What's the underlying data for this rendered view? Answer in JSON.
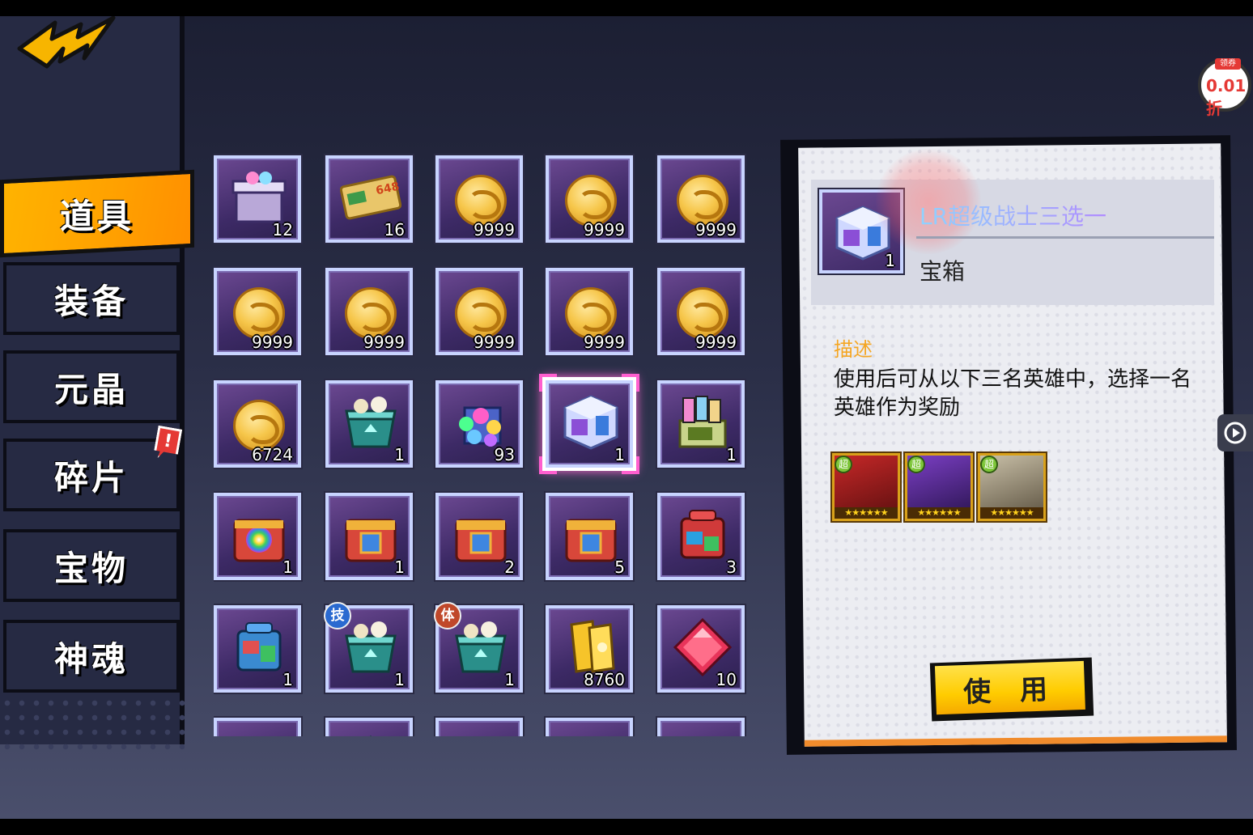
{
  "sidebar": {
    "tabs": [
      {
        "label": "道具",
        "active": true
      },
      {
        "label": "装备",
        "active": false
      },
      {
        "label": "元晶",
        "active": false
      },
      {
        "label": "碎片",
        "active": false,
        "alert": "!"
      },
      {
        "label": "宝物",
        "active": false
      },
      {
        "label": "神魂",
        "active": false
      }
    ]
  },
  "promo": {
    "top": "领券",
    "main": "0.01折"
  },
  "inventory": {
    "items": [
      {
        "icon": "gift-box-icon",
        "count": "12"
      },
      {
        "icon": "ticket-card-icon",
        "count": "16",
        "card_text": "648"
      },
      {
        "icon": "gold-coin-icon",
        "count": "9999"
      },
      {
        "icon": "gold-coin-icon",
        "count": "9999"
      },
      {
        "icon": "gold-coin-icon",
        "count": "9999"
      },
      {
        "icon": "gold-coin-icon",
        "count": "9999"
      },
      {
        "icon": "gold-coin-icon",
        "count": "9999"
      },
      {
        "icon": "gold-coin-icon",
        "count": "9999"
      },
      {
        "icon": "gold-coin-icon",
        "count": "9999"
      },
      {
        "icon": "gold-coin-icon",
        "count": "9999"
      },
      {
        "icon": "gold-coin-icon",
        "count": "6724"
      },
      {
        "icon": "crystal-chest-icon",
        "count": "1"
      },
      {
        "icon": "gem-pile-icon",
        "count": "93"
      },
      {
        "icon": "hero-cube-icon",
        "count": "1",
        "selected": true
      },
      {
        "icon": "card-box-icon",
        "count": "1"
      },
      {
        "icon": "rainbow-chest-icon",
        "count": "1"
      },
      {
        "icon": "red-chest-icon",
        "count": "1"
      },
      {
        "icon": "red-chest-icon",
        "count": "2"
      },
      {
        "icon": "red-chest-icon",
        "count": "5"
      },
      {
        "icon": "red-machine-icon",
        "count": "3"
      },
      {
        "icon": "blue-machine-icon",
        "count": "1"
      },
      {
        "icon": "crystal-chest-icon",
        "count": "1",
        "tag": "技"
      },
      {
        "icon": "crystal-chest-icon",
        "count": "1",
        "tag": "体"
      },
      {
        "icon": "gold-ticket-icon",
        "count": "8760"
      },
      {
        "icon": "red-gem-icon",
        "count": "10"
      },
      {
        "icon": "orange-card-icon",
        "count": ""
      },
      {
        "icon": "green-gem-icon",
        "count": ""
      },
      {
        "icon": "blue-item-icon",
        "count": ""
      },
      {
        "icon": "purple-item-icon",
        "count": ""
      },
      {
        "icon": "red-item-icon",
        "count": ""
      }
    ]
  },
  "detail": {
    "count": "1",
    "title": "LR超级战士三选一",
    "type": "宝箱",
    "desc_label": "描述",
    "desc_text": "使用后可从以下三名英雄中，选择一名英雄作为奖励",
    "heroes": [
      {
        "badge": "超",
        "colors": [
          "#c62828",
          "#5d0f0f"
        ]
      },
      {
        "badge": "超",
        "colors": [
          "#7b3fc4",
          "#2a1450"
        ]
      },
      {
        "badge": "超",
        "colors": [
          "#c9c0a8",
          "#5c5240"
        ]
      }
    ],
    "use_button": "使 用"
  }
}
